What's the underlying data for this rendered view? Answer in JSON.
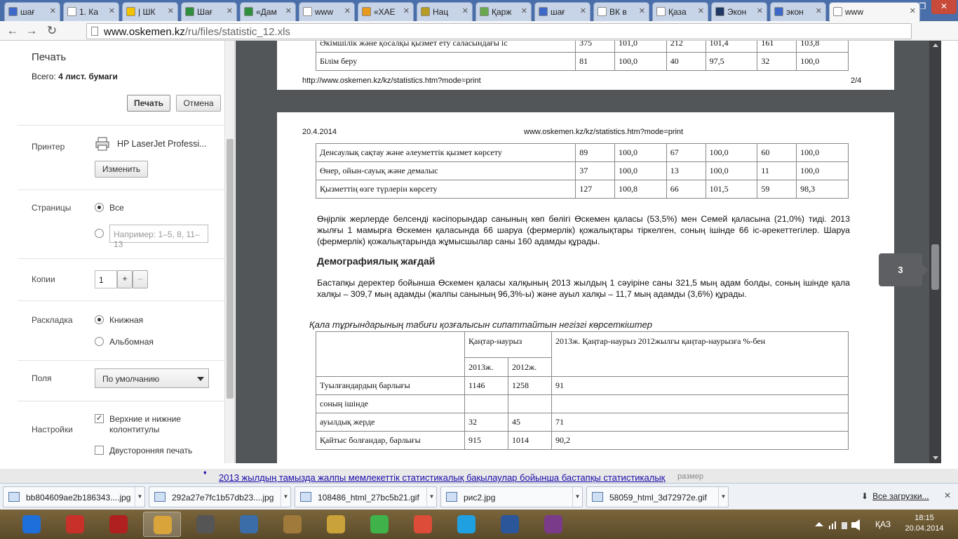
{
  "tabs": [
    {
      "label": "шағ",
      "fav": "#3d68c9"
    },
    {
      "label": "1. Ка",
      "fav": "#ffffff"
    },
    {
      "label": "| ШК",
      "fav": "#f2c200"
    },
    {
      "label": "Шағ",
      "fav": "#2f8f3d"
    },
    {
      "label": "«Дам",
      "fav": "#2f8f3d"
    },
    {
      "label": "www",
      "fav": "#ffffff"
    },
    {
      "label": "«ХАЕ",
      "fav": "#e89b1c"
    },
    {
      "label": "Нац",
      "fav": "#b89b22"
    },
    {
      "label": "Қарж",
      "fav": "#6aa84f"
    },
    {
      "label": "шағ",
      "fav": "#3d68c9"
    },
    {
      "label": "ВК в",
      "fav": "#ffffff"
    },
    {
      "label": "Қаза",
      "fav": "#ffffff"
    },
    {
      "label": "Экон",
      "fav": "#1f3864"
    },
    {
      "label": "экон",
      "fav": "#3d68c9"
    },
    {
      "label": "www",
      "fav": "#ffffff"
    }
  ],
  "toolbar": {
    "url_host": "www.oskemen.kz",
    "url_path": "/ru/files/statistic_12.xls"
  },
  "sidebar": {
    "title": "Печать",
    "total_prefix": "Всего: ",
    "total_value": "4 лист. бумаги",
    "print_button": "Печать",
    "cancel_button": "Отмена",
    "printer_label": "Принтер",
    "printer_name": "HP LaserJet Professi...",
    "change_button": "Изменить",
    "pages_label": "Страницы",
    "pages_all": "Все",
    "pages_placeholder": "Например: 1–5, 8, 11–13",
    "copies_label": "Копии",
    "copies_value": "1",
    "layout_label": "Раскладка",
    "layout_portrait": "Книжная",
    "layout_landscape": "Альбомная",
    "margins_label": "Поля",
    "margins_value": "По умолчанию",
    "settings_label": "Настройки",
    "headers_footers": "Верхние и нижние колонтитулы",
    "duplex": "Двусторонняя печать"
  },
  "page2": {
    "rows": [
      [
        "Әкімшілік және қосалқы қызмет ету саласындағы іс",
        "375",
        "101,0",
        "212",
        "101,4",
        "161",
        "103,8"
      ],
      [
        "Білім беру",
        "81",
        "100,0",
        "40",
        "97,5",
        "32",
        "100,0"
      ]
    ],
    "footer_url": "http://www.oskemen.kz/kz/statistics.htm?mode=print",
    "footer_page": "2/4"
  },
  "page3": {
    "date": "20.4.2014",
    "header_url": "www.oskemen.kz/kz/statistics.htm?mode=print",
    "rows": [
      [
        "Денсаулық сақтау және әлеуметтік қызмет көрсету",
        "89",
        "100,0",
        "67",
        "100,0",
        "60",
        "100,0"
      ],
      [
        "Өнер, ойын-сауық және демалыс",
        "37",
        "100,0",
        "13",
        "100,0",
        "11",
        "100,0"
      ],
      [
        "Қызметтің өзге түрлерін көрсету",
        "127",
        "100,8",
        "66",
        "101,5",
        "59",
        "98,3"
      ]
    ],
    "para1": "Өңірлік жерлерде белсенді кәсіпорындар санының көп бөлігі Өскемен қаласы (53,5%) мен Семей қаласына (21,0%) тиді. 2013 жылғы 1 мамырға Өскемен қаласында 66 шаруа (фермерлік) қожалықтары тіркелген, соның ішінде 66 іс-әрекеттегілер. Шаруа (фермерлік) қожалықтарында жұмысшылар саны 160 адамды құрады.",
    "heading": "Демографиялық жағдай",
    "para2": "Бастапқы деректер бойынша Өскемен қаласы халқының 2013 жылдың 1 сәуіріне саны 321,5 мың адам болды, соның ішінде қала халқы – 309,7 мың адамды (жалпы санының 96,3%-ы) және ауыл халқы – 11,7 мың адамды (3,6%) құрады.",
    "caption": "Қала тұрғындарының табиғи қозғалысын сипаттайтын негізгі көрсеткіштер",
    "t2_head_period": "Қаңтар-наурыз",
    "t2_head_y1": "2013ж.",
    "t2_head_y2": "2012ж.",
    "t2_head_pct": "2013ж. Қаңтар-наурыз 2012жылғы қаңтар-наурызға %-бен",
    "t2_rows": [
      [
        "Туылғандардың барлығы",
        "1146",
        "1258",
        "91"
      ],
      [
        "соның ішінде",
        "",
        "",
        ""
      ],
      [
        "ауылдық жерде",
        "32",
        "45",
        "71"
      ],
      [
        "Қайтыс  болғандар, барлығы",
        "915",
        "1014",
        "90,2"
      ]
    ],
    "page_tip": "3"
  },
  "below": {
    "link": "2013 жылдың тамызда жалпы мемлекеттік статистикалық бақылаулар бойынша бастапқы статистикалық",
    "size_label": "размер"
  },
  "downloads": {
    "items": [
      "bb804609ae2b186343....jpg",
      "292a27e7fc1b57db23....jpg",
      "108486_html_27bc5b21.gif",
      "рис2.jpg",
      "58059_html_3d72972e.gif"
    ],
    "all": "Все загрузки..."
  },
  "taskbar": {
    "lang": "ҚАЗ",
    "time": "18:15",
    "date": "20.04.2014",
    "apps": [
      "#1e6fd9",
      "#c8302a",
      "#b02020",
      "#d9a53a",
      "#555555",
      "#3b6ea8",
      "#a07a3a",
      "#c9a23a",
      "#3fb24a",
      "#dd4b39",
      "#1fa0e0",
      "#2b579a",
      "#7a3b8a"
    ]
  }
}
